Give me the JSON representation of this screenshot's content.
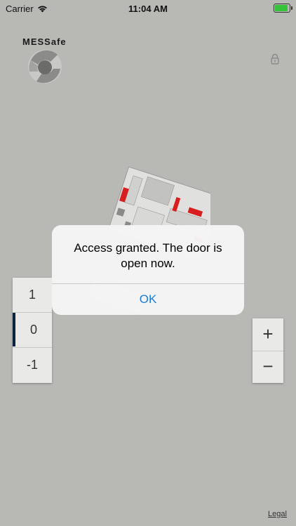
{
  "status_bar": {
    "carrier": "Carrier",
    "time": "11:04 AM"
  },
  "logo": {
    "brand": "MESSafe"
  },
  "floors": [
    {
      "label": "1"
    },
    {
      "label": "0",
      "selected": true
    },
    {
      "label": "-1"
    }
  ],
  "zoom": {
    "in_label": "+",
    "out_label": "−"
  },
  "footer": {
    "legal_link": "Legal"
  },
  "alert": {
    "message": "Access granted. The door is open now.",
    "ok_label": "OK"
  },
  "colors": {
    "accent": "#1a7bd6",
    "selected_floor": "#0c2340",
    "map_highlight": "#d81e1e",
    "background": "#b8b8b5"
  },
  "icons": {
    "wifi": "wifi-icon",
    "battery": "battery-charging-icon",
    "lock": "lock-icon"
  }
}
